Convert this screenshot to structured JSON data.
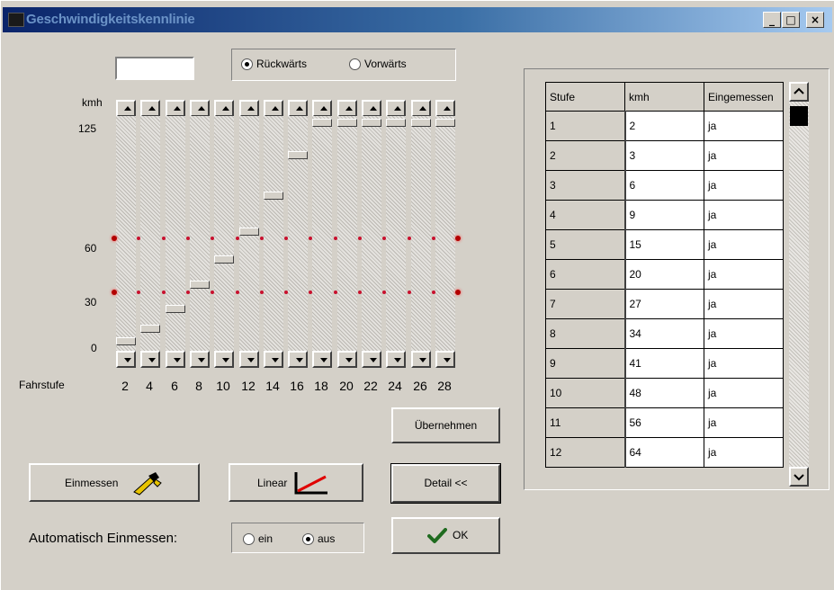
{
  "window": {
    "title": "Geschwindigkeitskennlinie"
  },
  "title_buttons": {
    "minimize": "_",
    "maximize": "□",
    "close": "×"
  },
  "direction": {
    "rueckwaerts": "Rückwärts",
    "vorwaerts": "Vorwärts",
    "selected": "Rückwärts"
  },
  "value_input": "",
  "chart": {
    "unit_label": "kmh",
    "y_ticks": [
      "125",
      "60",
      "30",
      "0"
    ],
    "x_title": "Fahrstufe",
    "x_ticks": [
      "2",
      "4",
      "6",
      "8",
      "10",
      "12",
      "14",
      "16",
      "18",
      "20",
      "22",
      "24",
      "26",
      "28"
    ],
    "y_max": 125,
    "reference_lines": [
      60,
      30
    ],
    "slider_values": [
      2,
      9,
      20,
      34,
      48,
      64,
      84,
      107,
      125,
      125,
      125,
      125,
      125,
      125
    ]
  },
  "buttons": {
    "uebernehmen": "Übernehmen",
    "einmessen": "Einmessen",
    "linear": "Linear",
    "detail": "Detail <<",
    "ok": "OK"
  },
  "auto": {
    "label": "Automatisch Einmessen:",
    "ein": "ein",
    "aus": "aus",
    "selected": "aus"
  },
  "table": {
    "headers": [
      "Stufe",
      "kmh",
      "Eingemessen"
    ],
    "rows": [
      [
        "1",
        "2",
        "ja"
      ],
      [
        "2",
        "3",
        "ja"
      ],
      [
        "3",
        "6",
        "ja"
      ],
      [
        "4",
        "9",
        "ja"
      ],
      [
        "5",
        "15",
        "ja"
      ],
      [
        "6",
        "20",
        "ja"
      ],
      [
        "7",
        "27",
        "ja"
      ],
      [
        "8",
        "34",
        "ja"
      ],
      [
        "9",
        "41",
        "ja"
      ],
      [
        "10",
        "48",
        "ja"
      ],
      [
        "11",
        "56",
        "ja"
      ],
      [
        "12",
        "64",
        "ja"
      ]
    ]
  },
  "colors": {
    "reference_dot": "#c8102e",
    "chrome": "#d4d0c8"
  },
  "icons": [
    "caliper-icon",
    "linear-chart-icon",
    "checkmark-icon",
    "scroll-up-icon",
    "scroll-down-icon",
    "app-icon"
  ]
}
